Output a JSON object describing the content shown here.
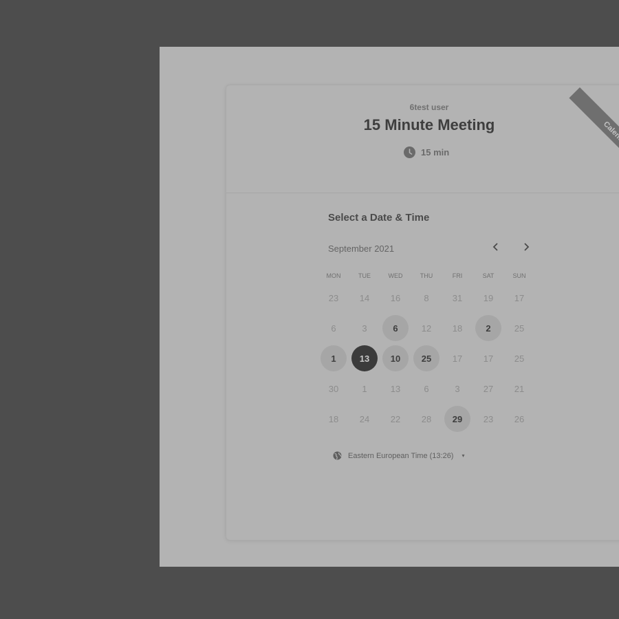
{
  "event": {
    "organizer": "6test user",
    "title": "15 Minute Meeting",
    "duration": "15 min"
  },
  "branding": {
    "ribbon_text": "Calendly"
  },
  "calendar": {
    "heading": "Select a Date & Time",
    "month": "September 2021",
    "weekdays": [
      "MON",
      "TUE",
      "WED",
      "THU",
      "FRI",
      "SAT",
      "SUN"
    ],
    "weeks": [
      [
        {
          "d": "23"
        },
        {
          "d": "14"
        },
        {
          "d": "16"
        },
        {
          "d": "8"
        },
        {
          "d": "31"
        },
        {
          "d": "19"
        },
        {
          "d": "17"
        }
      ],
      [
        {
          "d": "6"
        },
        {
          "d": "3"
        },
        {
          "d": "6",
          "s": "available"
        },
        {
          "d": "12"
        },
        {
          "d": "18"
        },
        {
          "d": "2",
          "s": "available"
        },
        {
          "d": "25"
        }
      ],
      [
        {
          "d": "1",
          "s": "available"
        },
        {
          "d": "13",
          "s": "selected"
        },
        {
          "d": "10",
          "s": "available"
        },
        {
          "d": "25",
          "s": "available"
        },
        {
          "d": "17"
        },
        {
          "d": "17"
        },
        {
          "d": "25"
        }
      ],
      [
        {
          "d": "30"
        },
        {
          "d": "1"
        },
        {
          "d": "13"
        },
        {
          "d": "6"
        },
        {
          "d": "3"
        },
        {
          "d": "27"
        },
        {
          "d": "21"
        }
      ],
      [
        {
          "d": "18"
        },
        {
          "d": "24"
        },
        {
          "d": "22"
        },
        {
          "d": "28"
        },
        {
          "d": "29",
          "s": "available"
        },
        {
          "d": "23"
        },
        {
          "d": "26"
        }
      ]
    ]
  },
  "timezone": {
    "label": "Eastern European Time (13:26)",
    "caret": "▾"
  },
  "colors": {
    "overlay": "#4d4d4d",
    "selected_day": "#3b3b3b",
    "available_day": "#a6a6a6"
  },
  "icons": {
    "duration": "clock-icon",
    "timezone": "globe-icon",
    "prev": "chevron-left-icon",
    "next": "chevron-right-icon"
  }
}
